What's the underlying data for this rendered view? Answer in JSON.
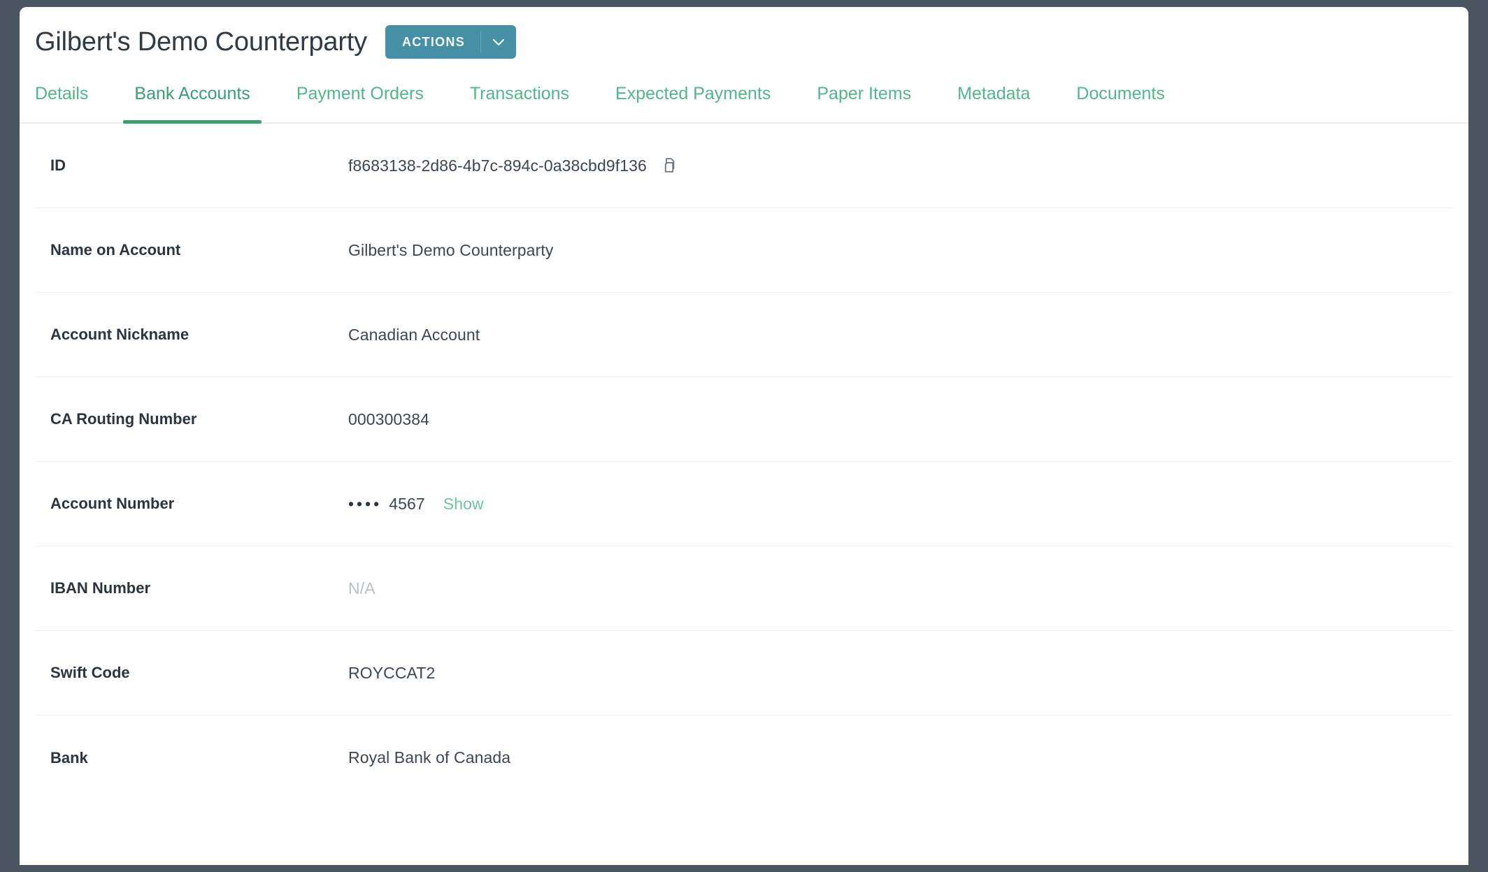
{
  "header": {
    "title": "Gilbert's Demo Counterparty",
    "actions_button": {
      "label": "ACTIONS",
      "caret_icon": "chevron-down-icon"
    },
    "accent_color": "#4590a5"
  },
  "tabs": {
    "active": "Bank Accounts",
    "accent_color": "#52b788",
    "items": [
      {
        "label": "Details"
      },
      {
        "label": "Bank Accounts"
      },
      {
        "label": "Payment Orders"
      },
      {
        "label": "Transactions"
      },
      {
        "label": "Expected Payments"
      },
      {
        "label": "Paper Items"
      },
      {
        "label": "Metadata"
      },
      {
        "label": "Documents"
      }
    ]
  },
  "details": {
    "rows": [
      {
        "label": "ID",
        "value": "f8683138-2d86-4b7c-894c-0a38cbd9f136",
        "copy_icon": "copy-icon"
      },
      {
        "label": "Name on Account",
        "value": "Gilbert's Demo Counterparty"
      },
      {
        "label": "Account Nickname",
        "value": "Canadian Account"
      },
      {
        "label": "CA Routing Number",
        "value": "000300384"
      },
      {
        "label": "Account Number",
        "masked_dots": "••••",
        "value": "4567",
        "show_label": "Show"
      },
      {
        "label": "IBAN Number",
        "value": "N/A"
      },
      {
        "label": "Swift Code",
        "value": "ROYCCAT2"
      },
      {
        "label": "Bank",
        "value": "Royal Bank of Canada"
      }
    ]
  }
}
